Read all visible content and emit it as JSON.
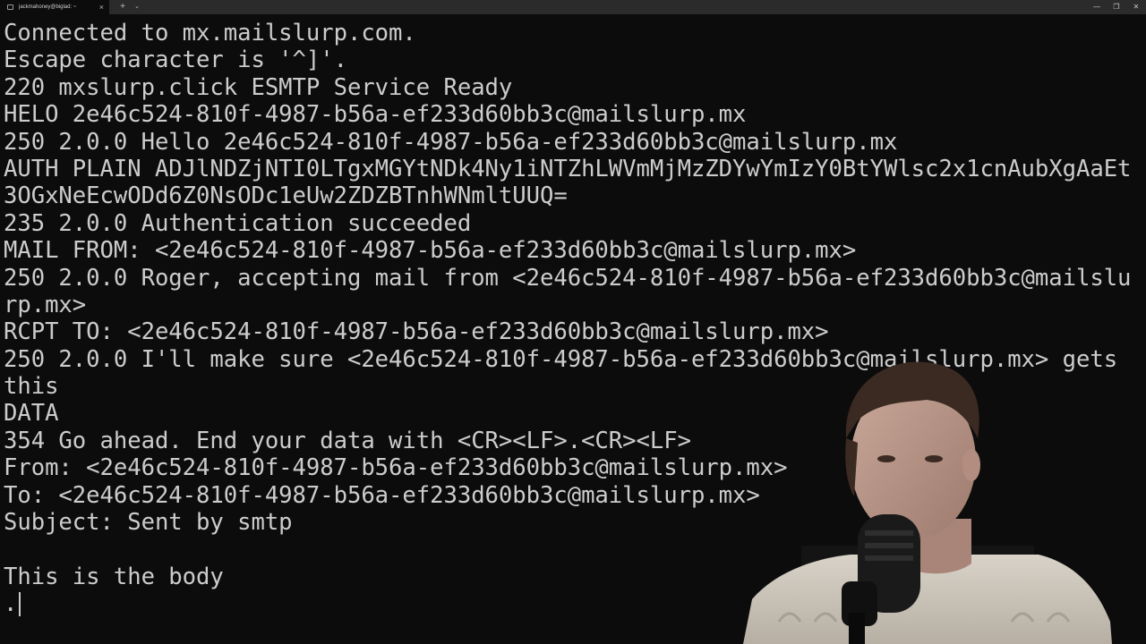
{
  "window": {
    "tab_title": "jackmahoney@biglad: ~",
    "tab_close_icon": "close-icon",
    "new_tab_icon": "plus-icon",
    "dropdown_icon": "chevron-down-icon",
    "controls": [
      "minimize-icon",
      "maximize-icon",
      "close-icon"
    ]
  },
  "terminal": {
    "lines": [
      "Connected to mx.mailslurp.com.",
      "Escape character is '^]'.",
      "220 mxslurp.click ESMTP Service Ready",
      "HELO 2e46c524-810f-4987-b56a-ef233d60bb3c@mailslurp.mx",
      "250 2.0.0 Hello 2e46c524-810f-4987-b56a-ef233d60bb3c@mailslurp.mx",
      "AUTH PLAIN ADJlNDZjNTI0LTgxMGYtNDk4Ny1iNTZhLWVmMjMzZDYwYmIzY0BtYWlsc2x1cnAubXgAaEt",
      "3OGxNeEcwODd6Z0NsODc1eUw2ZDZBTnhWNmltUUQ=",
      "235 2.0.0 Authentication succeeded",
      "MAIL FROM: <2e46c524-810f-4987-b56a-ef233d60bb3c@mailslurp.mx>",
      "250 2.0.0 Roger, accepting mail from <2e46c524-810f-4987-b56a-ef233d60bb3c@mailslu",
      "rp.mx>",
      "RCPT TO: <2e46c524-810f-4987-b56a-ef233d60bb3c@mailslurp.mx>",
      "250 2.0.0 I'll make sure <2e46c524-810f-4987-b56a-ef233d60bb3c@mailslurp.mx> gets",
      "this",
      "DATA",
      "354 Go ahead. End your data with <CR><LF>.<CR><LF>",
      "From: <2e46c524-810f-4987-b56a-ef233d60bb3c@mailslurp.mx>",
      "To: <2e46c524-810f-4987-b56a-ef233d60bb3c@mailslurp.mx>",
      "Subject: Sent by smtp",
      "",
      "This is the body",
      "."
    ]
  }
}
